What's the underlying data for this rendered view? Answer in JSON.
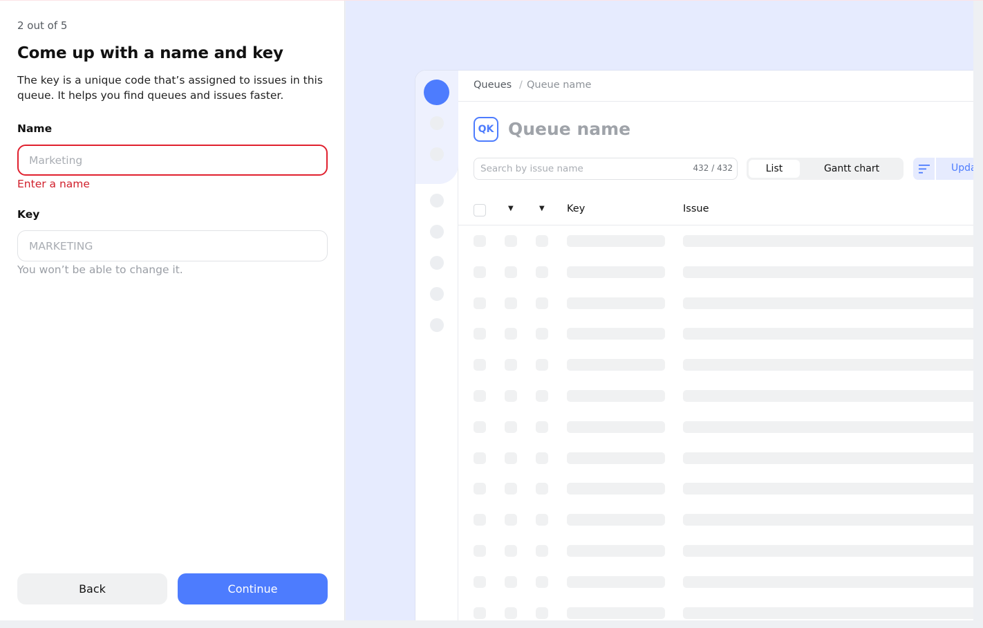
{
  "form": {
    "step": "2 out of 5",
    "title": "Come up with a name and key",
    "description": "The key is a unique code that’s assigned to issues in this queue. It helps you find queues and issues faster.",
    "name_label": "Name",
    "name_value": "",
    "name_placeholder": "Marketing",
    "name_error": "Enter a name",
    "key_label": "Key",
    "key_value": "",
    "key_placeholder": "MARKETING",
    "key_hint": "You won’t be able to change it.",
    "back_label": "Back",
    "continue_label": "Continue"
  },
  "preview": {
    "breadcrumb": [
      "Queues",
      "/",
      "Queue name"
    ],
    "queue_badge": "QK",
    "queue_title": "Queue name",
    "search_placeholder": "Search by issue name",
    "search_count": "432 / 432",
    "view_list": "List",
    "view_gantt": "Gantt chart",
    "update_label": "Upda",
    "columns": [
      "Key",
      "Issue"
    ],
    "sort_icon": "sort-lines-icon",
    "caret_icon": "caret-down-icon"
  },
  "colors": {
    "accent": "#4d7cfe",
    "error": "#e0202e",
    "preview_bg": "#e6ebfe",
    "skeleton": "#f0f1f2"
  }
}
